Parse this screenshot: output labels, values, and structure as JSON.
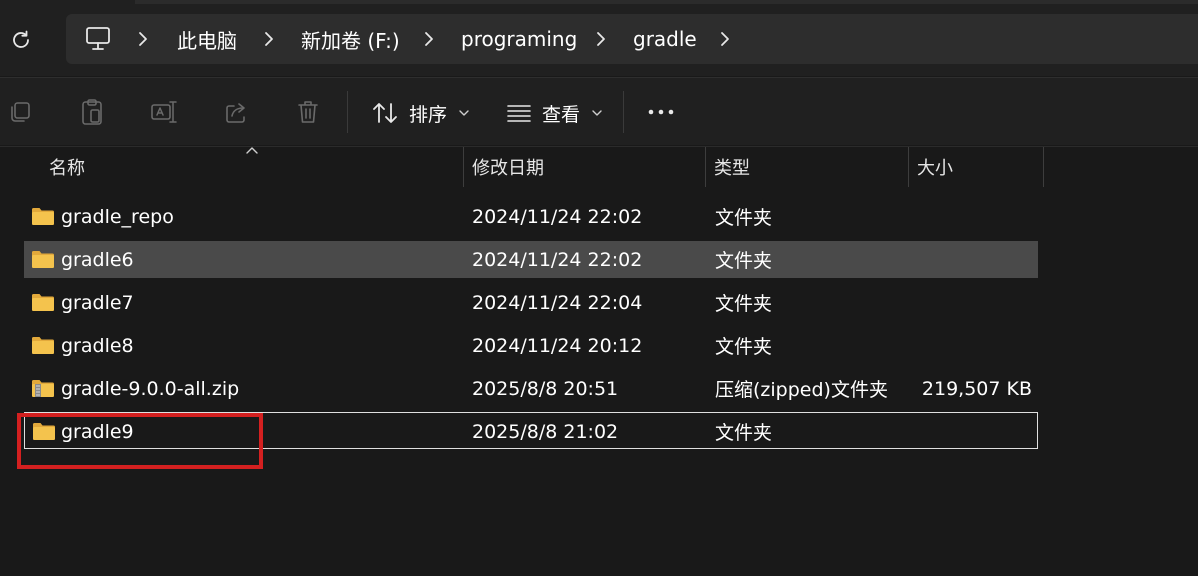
{
  "breadcrumb": {
    "items": [
      "此电脑",
      "新加卷 (F:)",
      "programing",
      "gradle"
    ]
  },
  "toolbar": {
    "sort_label": "排序",
    "view_label": "查看"
  },
  "columns": {
    "name": "名称",
    "modified": "修改日期",
    "type": "类型",
    "size": "大小"
  },
  "files": [
    {
      "name": "gradle_repo",
      "modified": "2024/11/24 22:02",
      "type": "文件夹",
      "size": "",
      "icon": "folder-icon"
    },
    {
      "name": "gradle6",
      "modified": "2024/11/24 22:02",
      "type": "文件夹",
      "size": "",
      "icon": "folder-icon"
    },
    {
      "name": "gradle7",
      "modified": "2024/11/24 22:04",
      "type": "文件夹",
      "size": "",
      "icon": "folder-icon"
    },
    {
      "name": "gradle8",
      "modified": "2024/11/24 20:12",
      "type": "文件夹",
      "size": "",
      "icon": "folder-icon"
    },
    {
      "name": "gradle-9.0.0-all.zip",
      "modified": "2025/8/8 20:51",
      "type": "压缩(zipped)文件夹",
      "size": "219,507 KB",
      "icon": "zip-folder-icon"
    },
    {
      "name": "gradle9",
      "modified": "2025/8/8 21:02",
      "type": "文件夹",
      "size": "",
      "icon": "folder-icon"
    }
  ],
  "colors": {
    "background": "#191919",
    "chrome": "#202020",
    "selected_row": "#4a4a4a",
    "highlight": "#d42020",
    "folder": "#f4c34d"
  }
}
